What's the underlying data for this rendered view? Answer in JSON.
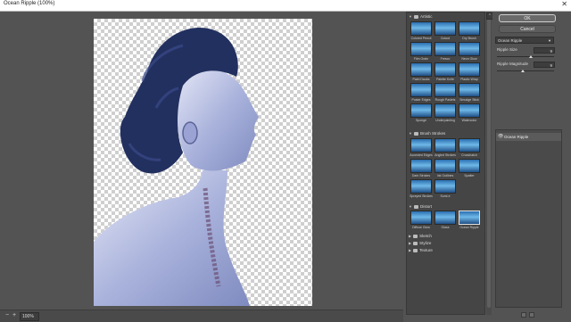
{
  "window": {
    "title": "Ocean Ripple (100%)",
    "close_glyph": "✕"
  },
  "status": {
    "zoom_out": "−",
    "zoom_in": "+",
    "zoom_value": "100%"
  },
  "gallery": {
    "categories": [
      {
        "name": "Artistic",
        "expanded": true,
        "filters": [
          "Colored Pencil",
          "Cutout",
          "Dry Brush",
          "Film Grain",
          "Fresco",
          "Neon Glow",
          "Paint Daubs",
          "Palette Knife",
          "Plastic Wrap",
          "Poster Edges",
          "Rough Pastels",
          "Smudge Stick",
          "Sponge",
          "Underpainting",
          "Watercolor"
        ]
      },
      {
        "name": "Brush Strokes",
        "expanded": true,
        "filters": [
          "Accented Edges",
          "Angled Strokes",
          "Crosshatch",
          "Dark Strokes",
          "Ink Outlines",
          "Spatter",
          "Sprayed Strokes",
          "Sumi-e"
        ]
      },
      {
        "name": "Distort",
        "expanded": true,
        "filters": [
          "Diffuse Glow",
          "Glass",
          "Ocean Ripple"
        ],
        "selected": "Ocean Ripple"
      },
      {
        "name": "Sketch",
        "expanded": false,
        "filters": []
      },
      {
        "name": "Stylize",
        "expanded": false,
        "filters": []
      },
      {
        "name": "Texture",
        "expanded": false,
        "filters": []
      }
    ]
  },
  "panel": {
    "ok_label": "OK",
    "cancel_label": "Cancel",
    "filter_select": "Ocean Ripple",
    "params": [
      {
        "label": "Ripple Size",
        "value": "9",
        "fraction": 0.6
      },
      {
        "label": "Ripple Magnitude",
        "value": "9",
        "fraction": 0.45
      }
    ],
    "layers": [
      {
        "name": "Ocean Ripple",
        "visible_glyph": "👁"
      }
    ]
  },
  "colors": {
    "panel_bg": "#535353",
    "thumb_sky": "#2b6fb0",
    "artwork_tint": "#8a96c8",
    "hair": "#1f2a5a"
  }
}
